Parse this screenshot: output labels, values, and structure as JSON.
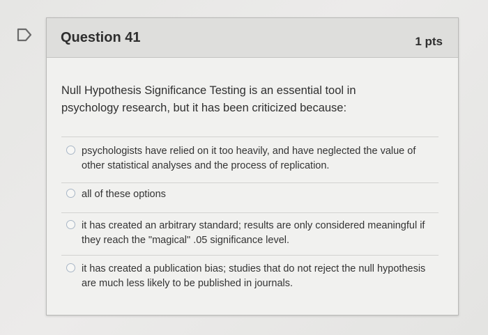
{
  "question": {
    "title": "Question 41",
    "points": "1 pts",
    "text": "Null Hypothesis Significance Testing is an essential tool in psychology research, but it has been criticized because:"
  },
  "answers": [
    {
      "text": "psychologists have relied on it too heavily, and have neglected the value of other statistical analyses and the process of replication."
    },
    {
      "text": "all of these options"
    },
    {
      "text": "it has created an arbitrary standard; results are only considered meaningful if they reach the \"magical\" .05 significance level."
    },
    {
      "text": "it has created a publication bias; studies that do not reject the null hypothesis are much less likely to be published in journals."
    }
  ],
  "icons": {
    "flag": "flag-icon"
  },
  "colors": {
    "header_bg": "#dededc",
    "radio_border": "#a8b6c6"
  }
}
